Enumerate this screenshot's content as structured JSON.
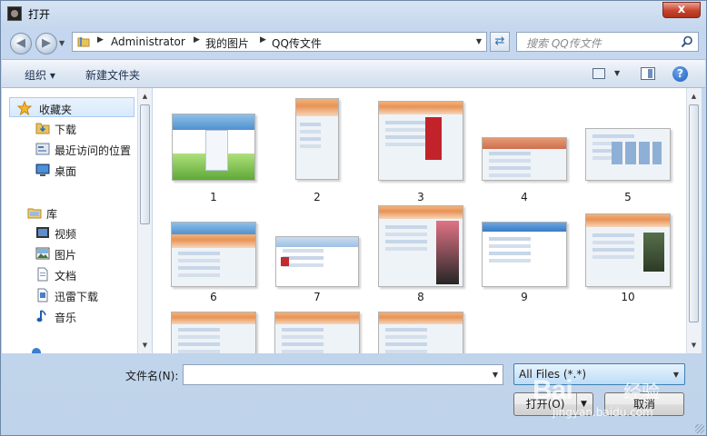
{
  "window": {
    "title": "打开",
    "close_glyph": "x"
  },
  "address": {
    "crumbs": [
      "Administrator",
      "我的图片",
      "QQ传文件"
    ]
  },
  "search": {
    "placeholder": "搜索 QQ传文件"
  },
  "toolbar": {
    "organize": "组织 ▾",
    "new_folder": "新建文件夹"
  },
  "nav": {
    "favorites": {
      "label": "收藏夹",
      "items": [
        {
          "label": "下载",
          "icon": "download-folder-icon"
        },
        {
          "label": "最近访问的位置",
          "icon": "recent-places-icon"
        },
        {
          "label": "桌面",
          "icon": "desktop-icon"
        }
      ]
    },
    "libraries": {
      "label": "库",
      "items": [
        {
          "label": "视频",
          "icon": "video-library-icon"
        },
        {
          "label": "图片",
          "icon": "pictures-library-icon"
        },
        {
          "label": "文档",
          "icon": "documents-library-icon"
        },
        {
          "label": "迅雷下载",
          "icon": "thunder-download-icon"
        },
        {
          "label": "音乐",
          "icon": "music-library-icon"
        }
      ]
    }
  },
  "files": {
    "items": [
      {
        "label": "1"
      },
      {
        "label": "2"
      },
      {
        "label": "3"
      },
      {
        "label": "4"
      },
      {
        "label": "5"
      },
      {
        "label": "6"
      },
      {
        "label": "7"
      },
      {
        "label": "8"
      },
      {
        "label": "9"
      },
      {
        "label": "10"
      },
      {
        "label": ""
      },
      {
        "label": ""
      },
      {
        "label": ""
      }
    ]
  },
  "bottom": {
    "filename_label": "文件名(N):",
    "filename_value": "",
    "filetype": "All Files (*.*)",
    "open_label": "打开(O)",
    "cancel_label": "取消"
  },
  "watermark": {
    "logo": "Bai",
    "text": "经验",
    "url": "jingyan.baidu.com"
  },
  "colors": {
    "selection": "#d7e9fb",
    "filetype_accent": "#3c7fb1",
    "close": "#c7432c"
  }
}
